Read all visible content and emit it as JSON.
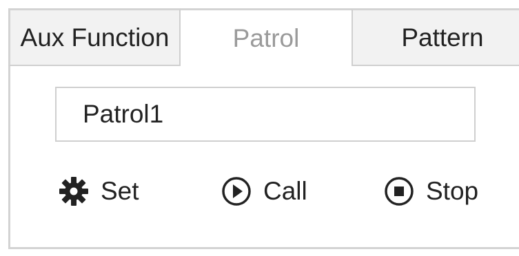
{
  "tabs": {
    "aux_label": "Aux Function",
    "patrol_label": "Patrol",
    "pattern_label": "Pattern",
    "active": "Patrol"
  },
  "patrol_select": {
    "value": "Patrol1"
  },
  "actions": {
    "set_label": "Set",
    "set_icon": "gear-icon",
    "call_label": "Call",
    "call_icon": "play-circle-icon",
    "stop_label": "Stop",
    "stop_icon": "stop-circle-icon"
  },
  "colors": {
    "active_tab_text": "#9a9a9a",
    "tab_background": "#f2f2f2",
    "border": "#d3d3d3",
    "text": "#222222"
  }
}
